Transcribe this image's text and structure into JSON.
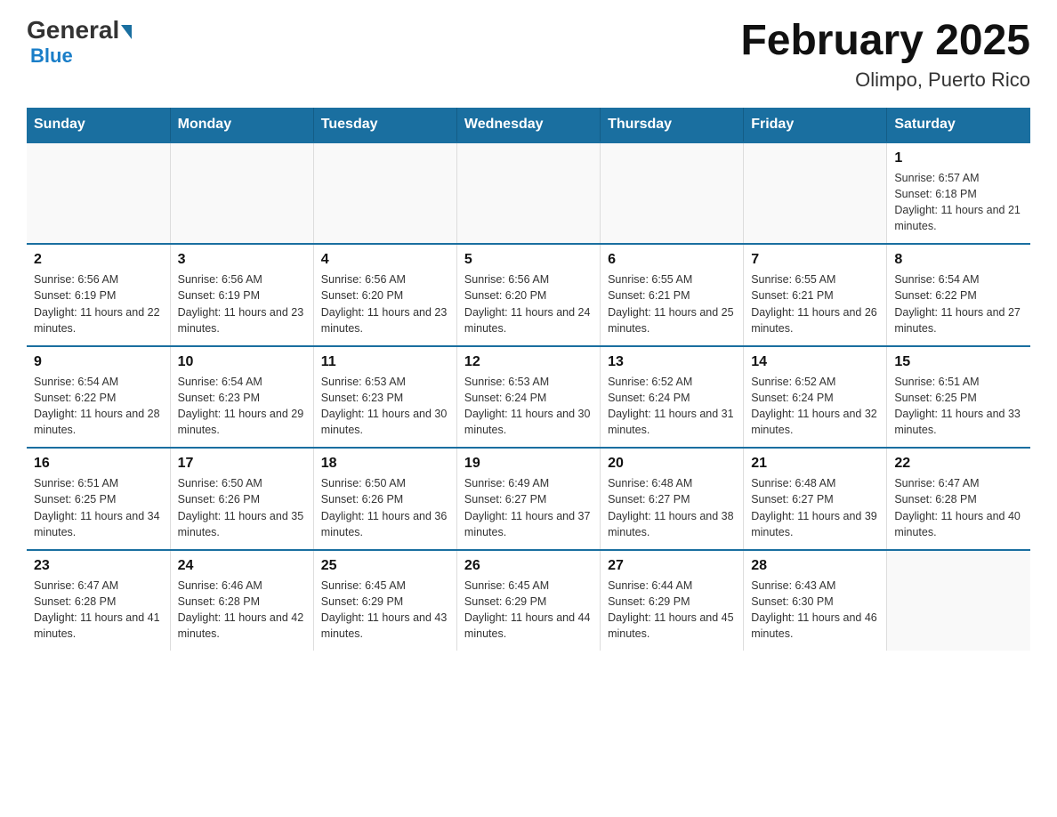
{
  "header": {
    "logo_line1": "General",
    "logo_line2": "Blue",
    "title": "February 2025",
    "subtitle": "Olimpo, Puerto Rico"
  },
  "days_of_week": [
    "Sunday",
    "Monday",
    "Tuesday",
    "Wednesday",
    "Thursday",
    "Friday",
    "Saturday"
  ],
  "weeks": [
    [
      {
        "day": "",
        "detail": "",
        "empty": true
      },
      {
        "day": "",
        "detail": "",
        "empty": true
      },
      {
        "day": "",
        "detail": "",
        "empty": true
      },
      {
        "day": "",
        "detail": "",
        "empty": true
      },
      {
        "day": "",
        "detail": "",
        "empty": true
      },
      {
        "day": "",
        "detail": "",
        "empty": true
      },
      {
        "day": "1",
        "detail": "Sunrise: 6:57 AM\nSunset: 6:18 PM\nDaylight: 11 hours and 21 minutes.",
        "empty": false
      }
    ],
    [
      {
        "day": "2",
        "detail": "Sunrise: 6:56 AM\nSunset: 6:19 PM\nDaylight: 11 hours and 22 minutes.",
        "empty": false
      },
      {
        "day": "3",
        "detail": "Sunrise: 6:56 AM\nSunset: 6:19 PM\nDaylight: 11 hours and 23 minutes.",
        "empty": false
      },
      {
        "day": "4",
        "detail": "Sunrise: 6:56 AM\nSunset: 6:20 PM\nDaylight: 11 hours and 23 minutes.",
        "empty": false
      },
      {
        "day": "5",
        "detail": "Sunrise: 6:56 AM\nSunset: 6:20 PM\nDaylight: 11 hours and 24 minutes.",
        "empty": false
      },
      {
        "day": "6",
        "detail": "Sunrise: 6:55 AM\nSunset: 6:21 PM\nDaylight: 11 hours and 25 minutes.",
        "empty": false
      },
      {
        "day": "7",
        "detail": "Sunrise: 6:55 AM\nSunset: 6:21 PM\nDaylight: 11 hours and 26 minutes.",
        "empty": false
      },
      {
        "day": "8",
        "detail": "Sunrise: 6:54 AM\nSunset: 6:22 PM\nDaylight: 11 hours and 27 minutes.",
        "empty": false
      }
    ],
    [
      {
        "day": "9",
        "detail": "Sunrise: 6:54 AM\nSunset: 6:22 PM\nDaylight: 11 hours and 28 minutes.",
        "empty": false
      },
      {
        "day": "10",
        "detail": "Sunrise: 6:54 AM\nSunset: 6:23 PM\nDaylight: 11 hours and 29 minutes.",
        "empty": false
      },
      {
        "day": "11",
        "detail": "Sunrise: 6:53 AM\nSunset: 6:23 PM\nDaylight: 11 hours and 30 minutes.",
        "empty": false
      },
      {
        "day": "12",
        "detail": "Sunrise: 6:53 AM\nSunset: 6:24 PM\nDaylight: 11 hours and 30 minutes.",
        "empty": false
      },
      {
        "day": "13",
        "detail": "Sunrise: 6:52 AM\nSunset: 6:24 PM\nDaylight: 11 hours and 31 minutes.",
        "empty": false
      },
      {
        "day": "14",
        "detail": "Sunrise: 6:52 AM\nSunset: 6:24 PM\nDaylight: 11 hours and 32 minutes.",
        "empty": false
      },
      {
        "day": "15",
        "detail": "Sunrise: 6:51 AM\nSunset: 6:25 PM\nDaylight: 11 hours and 33 minutes.",
        "empty": false
      }
    ],
    [
      {
        "day": "16",
        "detail": "Sunrise: 6:51 AM\nSunset: 6:25 PM\nDaylight: 11 hours and 34 minutes.",
        "empty": false
      },
      {
        "day": "17",
        "detail": "Sunrise: 6:50 AM\nSunset: 6:26 PM\nDaylight: 11 hours and 35 minutes.",
        "empty": false
      },
      {
        "day": "18",
        "detail": "Sunrise: 6:50 AM\nSunset: 6:26 PM\nDaylight: 11 hours and 36 minutes.",
        "empty": false
      },
      {
        "day": "19",
        "detail": "Sunrise: 6:49 AM\nSunset: 6:27 PM\nDaylight: 11 hours and 37 minutes.",
        "empty": false
      },
      {
        "day": "20",
        "detail": "Sunrise: 6:48 AM\nSunset: 6:27 PM\nDaylight: 11 hours and 38 minutes.",
        "empty": false
      },
      {
        "day": "21",
        "detail": "Sunrise: 6:48 AM\nSunset: 6:27 PM\nDaylight: 11 hours and 39 minutes.",
        "empty": false
      },
      {
        "day": "22",
        "detail": "Sunrise: 6:47 AM\nSunset: 6:28 PM\nDaylight: 11 hours and 40 minutes.",
        "empty": false
      }
    ],
    [
      {
        "day": "23",
        "detail": "Sunrise: 6:47 AM\nSunset: 6:28 PM\nDaylight: 11 hours and 41 minutes.",
        "empty": false
      },
      {
        "day": "24",
        "detail": "Sunrise: 6:46 AM\nSunset: 6:28 PM\nDaylight: 11 hours and 42 minutes.",
        "empty": false
      },
      {
        "day": "25",
        "detail": "Sunrise: 6:45 AM\nSunset: 6:29 PM\nDaylight: 11 hours and 43 minutes.",
        "empty": false
      },
      {
        "day": "26",
        "detail": "Sunrise: 6:45 AM\nSunset: 6:29 PM\nDaylight: 11 hours and 44 minutes.",
        "empty": false
      },
      {
        "day": "27",
        "detail": "Sunrise: 6:44 AM\nSunset: 6:29 PM\nDaylight: 11 hours and 45 minutes.",
        "empty": false
      },
      {
        "day": "28",
        "detail": "Sunrise: 6:43 AM\nSunset: 6:30 PM\nDaylight: 11 hours and 46 minutes.",
        "empty": false
      },
      {
        "day": "",
        "detail": "",
        "empty": true
      }
    ]
  ]
}
